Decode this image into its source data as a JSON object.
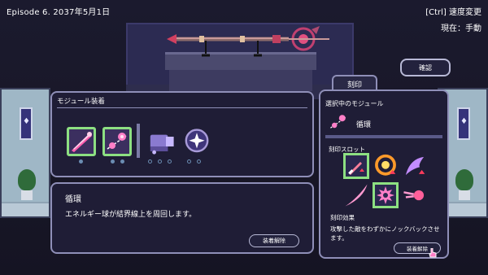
{
  "hud": {
    "episode": "Episode 6. 2037年5月1日",
    "speed_control": "[Ctrl] 速度変更",
    "mode": "現在：手動"
  },
  "confirm_button": "確認",
  "weapon": {
    "icon": "magic-staff"
  },
  "modules_panel": {
    "title": "モジュール装着",
    "slots": [
      {
        "icon": "laser-beam-icon",
        "equipped": true,
        "dots": 1
      },
      {
        "icon": "orbit-energy-ball-icon",
        "equipped": true,
        "dots": 2
      },
      {
        "icon": "cannon-icon",
        "equipped": false,
        "dots": 3
      },
      {
        "icon": "sparkle-orb-icon",
        "equipped": false,
        "dots": 2
      }
    ]
  },
  "description_panel": {
    "name": "循環",
    "text": "エネルギー球が結界線上を周回します。",
    "unequip_label": "装着解除"
  },
  "engrave_panel": {
    "tab_label": "刻印",
    "selected_label": "選択中のモジュール",
    "selected_name": "循環",
    "selected_icon": "orbit-energy-ball-icon",
    "slots_label": "刻印スロット",
    "slots": [
      {
        "icon": "sword-up-icon",
        "equipped": true
      },
      {
        "icon": "fire-ring-icon",
        "equipped": false
      },
      {
        "icon": "wing-up-icon",
        "equipped": false
      },
      {
        "icon": "pink-slash-icon",
        "equipped": false
      },
      {
        "icon": "gear-burst-icon",
        "equipped": true
      },
      {
        "icon": "comet-icon",
        "equipped": false
      }
    ],
    "effect_label": "刻印効果",
    "effect_text": "攻撃した敵をわずかにノックバックさせます。",
    "unequip_label": "装着解除"
  },
  "colors": {
    "panel_bg": "#1f1d36",
    "panel_border": "#8f8fb8",
    "equipped_border": "#8de082",
    "accent_purple": "#c38cff"
  }
}
